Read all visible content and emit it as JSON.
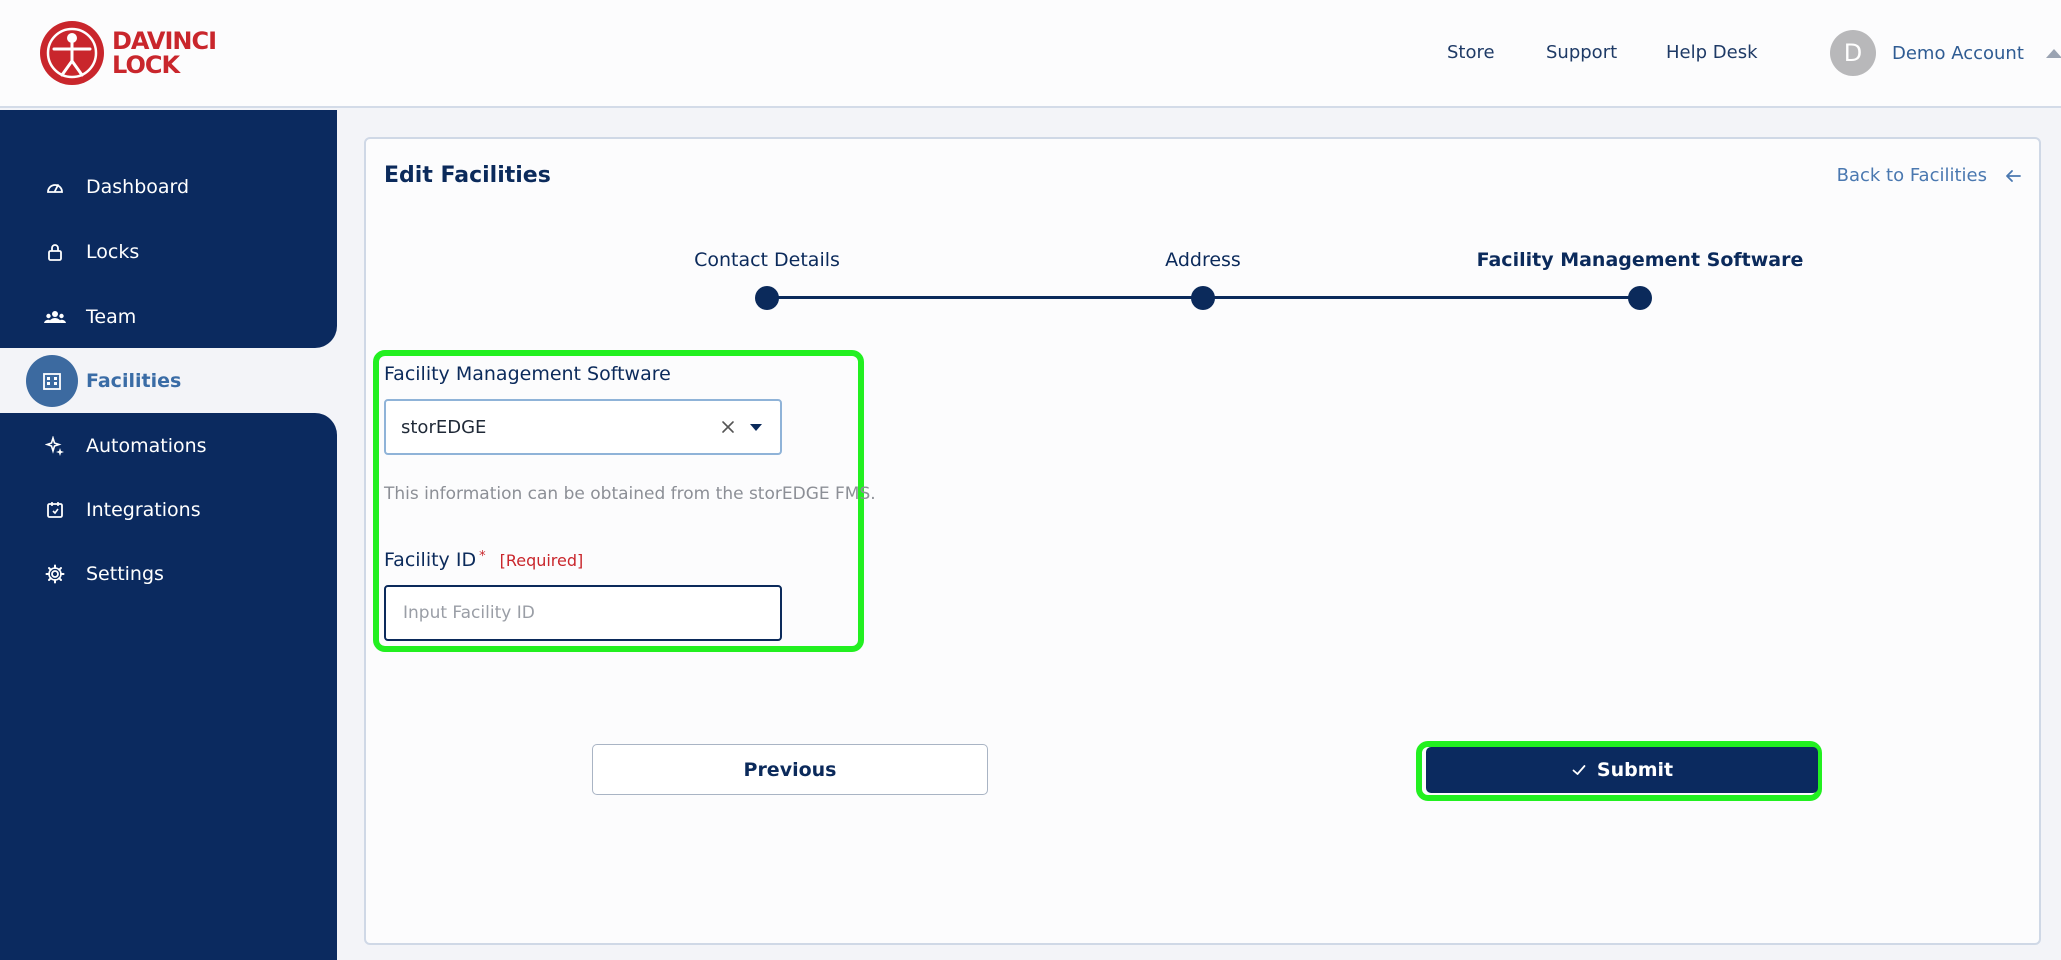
{
  "header": {
    "logo_line1": "DAVINCI",
    "logo_line2": "LOCK",
    "nav": [
      "Store",
      "Support",
      "Help Desk"
    ],
    "account_initial": "D",
    "account_name": "Demo Account"
  },
  "sidebar": {
    "items": [
      {
        "label": "Dashboard",
        "icon": "gauge-icon"
      },
      {
        "label": "Locks",
        "icon": "lock-icon"
      },
      {
        "label": "Team",
        "icon": "team-icon"
      },
      {
        "label": "Facilities",
        "icon": "building-icon",
        "active": true
      },
      {
        "label": "Automations",
        "icon": "sparkle-icon"
      },
      {
        "label": "Integrations",
        "icon": "integration-icon"
      },
      {
        "label": "Settings",
        "icon": "gear-icon"
      }
    ]
  },
  "card": {
    "title": "Edit Facilities",
    "back_label": "Back to Facilities",
    "steps": [
      {
        "label": "Contact Details"
      },
      {
        "label": "Address"
      },
      {
        "label": "Facility Management Software",
        "active": true
      }
    ],
    "fms_label": "Facility Management Software",
    "fms_value": "storEDGE",
    "helper_text": "This information can be obtained from the storEDGE FMS.",
    "facility_id_label": "Facility ID",
    "required_star": "*",
    "required_tag": "[Required]",
    "facility_id_placeholder": "Input Facility ID",
    "facility_id_value": "",
    "previous_label": "Previous",
    "submit_label": "Submit"
  },
  "colors": {
    "navy": "#0b2a5f",
    "accent_blue": "#3c6aa0",
    "highlight": "#22f020",
    "brand_red": "#c9262c"
  }
}
